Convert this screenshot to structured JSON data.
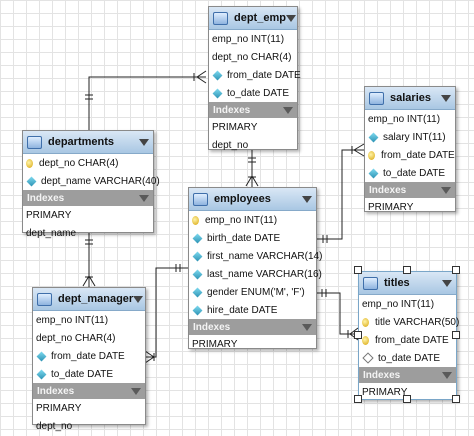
{
  "indexes_label": "Indexes",
  "tables": {
    "dept_emp": {
      "name": "dept_emp",
      "fields": [
        {
          "icon": "none",
          "text": "emp_no INT(11)"
        },
        {
          "icon": "none",
          "text": "dept_no CHAR(4)"
        },
        {
          "icon": "diamond",
          "text": "from_date DATE"
        },
        {
          "icon": "diamond",
          "text": "to_date DATE"
        }
      ],
      "indexes": [
        "PRIMARY",
        "dept_no"
      ]
    },
    "departments": {
      "name": "departments",
      "fields": [
        {
          "icon": "key",
          "text": "dept_no CHAR(4)"
        },
        {
          "icon": "diamond",
          "text": "dept_name VARCHAR(40)"
        }
      ],
      "indexes": [
        "PRIMARY",
        "dept_name"
      ]
    },
    "salaries": {
      "name": "salaries",
      "fields": [
        {
          "icon": "none",
          "text": "emp_no INT(11)"
        },
        {
          "icon": "diamond",
          "text": "salary INT(11)"
        },
        {
          "icon": "key",
          "text": "from_date DATE"
        },
        {
          "icon": "diamond",
          "text": "to_date DATE"
        }
      ],
      "indexes": [
        "PRIMARY"
      ]
    },
    "employees": {
      "name": "employees",
      "fields": [
        {
          "icon": "key",
          "text": "emp_no INT(11)"
        },
        {
          "icon": "diamond",
          "text": "birth_date DATE"
        },
        {
          "icon": "diamond",
          "text": "first_name VARCHAR(14)"
        },
        {
          "icon": "diamond",
          "text": "last_name VARCHAR(16)"
        },
        {
          "icon": "diamond",
          "text": "gender ENUM('M', 'F')"
        },
        {
          "icon": "diamond",
          "text": "hire_date DATE"
        }
      ],
      "indexes": [
        "PRIMARY"
      ]
    },
    "dept_manager": {
      "name": "dept_manager",
      "fields": [
        {
          "icon": "none",
          "text": "emp_no INT(11)"
        },
        {
          "icon": "none",
          "text": "dept_no CHAR(4)"
        },
        {
          "icon": "diamond",
          "text": "from_date DATE"
        },
        {
          "icon": "diamond",
          "text": "to_date DATE"
        }
      ],
      "indexes": [
        "PRIMARY",
        "dept_no"
      ]
    },
    "titles": {
      "name": "titles",
      "fields": [
        {
          "icon": "none",
          "text": "emp_no INT(11)"
        },
        {
          "icon": "key",
          "text": "title VARCHAR(50)"
        },
        {
          "icon": "key",
          "text": "from_date DATE"
        },
        {
          "icon": "diamond_outline",
          "text": "to_date DATE"
        }
      ],
      "indexes": [
        "PRIMARY"
      ]
    }
  }
}
